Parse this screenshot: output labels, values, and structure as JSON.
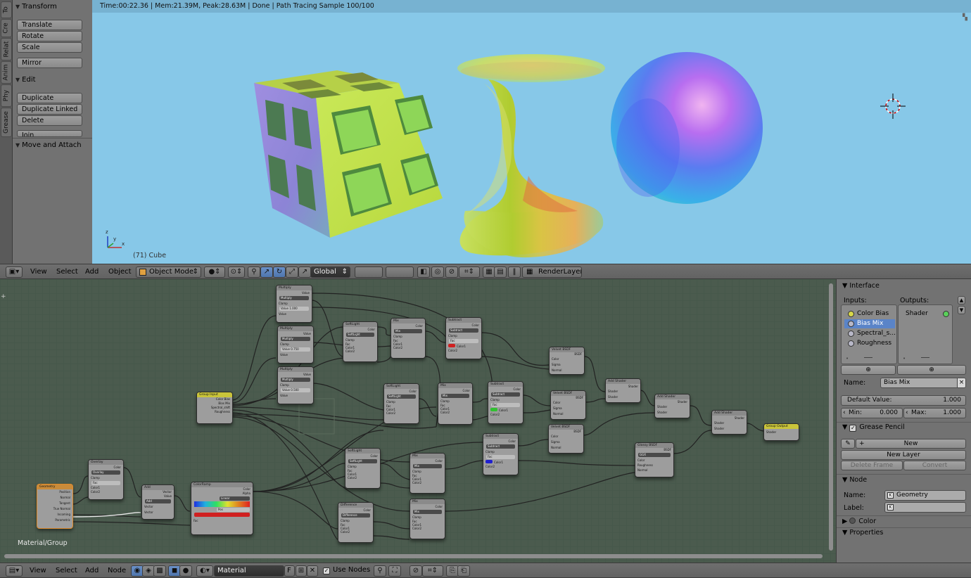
{
  "tool_shelf": {
    "tabs": [
      "To",
      "Cre",
      "Relat",
      "Anim",
      "Phy",
      "Grease"
    ],
    "transform": {
      "title": "Transform",
      "buttons": [
        "Translate",
        "Rotate",
        "Scale",
        "Mirror"
      ]
    },
    "edit": {
      "title": "Edit",
      "buttons": [
        "Duplicate",
        "Duplicate Linked",
        "Delete",
        "Join"
      ]
    },
    "move_attach": {
      "title": "Move and Attach"
    }
  },
  "viewport": {
    "status": "Time:00:22.36 | Mem:21.39M, Peak:28.63M | Done | Path Tracing Sample 100/100",
    "object_label": "(71) Cube"
  },
  "header_3d": {
    "menus": [
      "View",
      "Select",
      "Add",
      "Object"
    ],
    "mode": "Object Mode",
    "orientation": "Global",
    "render_layer": "RenderLayer"
  },
  "node_editor": {
    "path": "Material/Group",
    "nodes": {
      "multiply": "Multiply",
      "value": "Value",
      "clamp": "Clamp",
      "value_1": "Value 1.000",
      "value_075": "Value 0.750",
      "value_05": "Value 0.500",
      "softlight": "SoftLight",
      "mix": "Mix",
      "subtract": "Subtract",
      "color": "Color",
      "fac": "Fac",
      "color1": "Color1",
      "color2": "Color2",
      "group_input": "Group Input",
      "inputs": [
        "Color Bias",
        "Bias Mix",
        "Spectral_shift",
        "Roughness"
      ],
      "velvet": "Velvet BSDF",
      "bsdf": "BSDF",
      "sigma": "Sigma",
      "normal": "Normal",
      "add_shader": "Add Shader",
      "shader": "Shader",
      "group_output": "Group Output",
      "glossy": "Glossy BSDF",
      "ggx": "GGX",
      "roughness": "Roughness",
      "overlay": "Overlay",
      "add": "Add",
      "vector": "Vector",
      "colorramp": "ColorRamp",
      "alpha": "Alpha",
      "linear": "Linear",
      "pos": "Pos",
      "difference": "Difference",
      "geometry": "Geometry",
      "geo_outputs": [
        "Position",
        "Normal",
        "Tangent",
        "True Normal",
        "Incoming",
        "Parametric",
        "Backfacing"
      ]
    }
  },
  "properties": {
    "interface_title": "Interface",
    "inputs_label": "Inputs:",
    "outputs_label": "Outputs:",
    "inputs": [
      "Color Bias",
      "Bias Mix",
      "Spectral_s...",
      "Roughness"
    ],
    "input_colors": [
      "#d8d84a",
      "#b8b8c8",
      "#b8b8c8",
      "#b8b8c8"
    ],
    "selected_input": "Bias Mix",
    "outputs": [
      "Shader"
    ],
    "output_color": "#5ad05a",
    "name_label": "Name:",
    "name_value": "Bias Mix",
    "default_label": "Default Value:",
    "default_value": "1.000",
    "min_label": "Min:",
    "min_value": "0.000",
    "max_label": "Max:",
    "max_value": "1.000",
    "grease_pencil": "Grease Pencil",
    "new_btn": "New",
    "new_layer_btn": "New Layer",
    "delete_frame_btn": "Delete Frame",
    "convert_btn": "Convert",
    "node_title": "Node",
    "node_name_label": "Name:",
    "node_name_value": "Geometry",
    "node_label_label": "Label:",
    "color_title": "Color",
    "properties_title": "Properties"
  },
  "header_node": {
    "menus": [
      "View",
      "Select",
      "Add",
      "Node"
    ],
    "material": "Material",
    "fake_user": "F",
    "use_nodes_label": "Use Nodes",
    "use_nodes_checked": true
  },
  "accent_color": "#5a84c8"
}
